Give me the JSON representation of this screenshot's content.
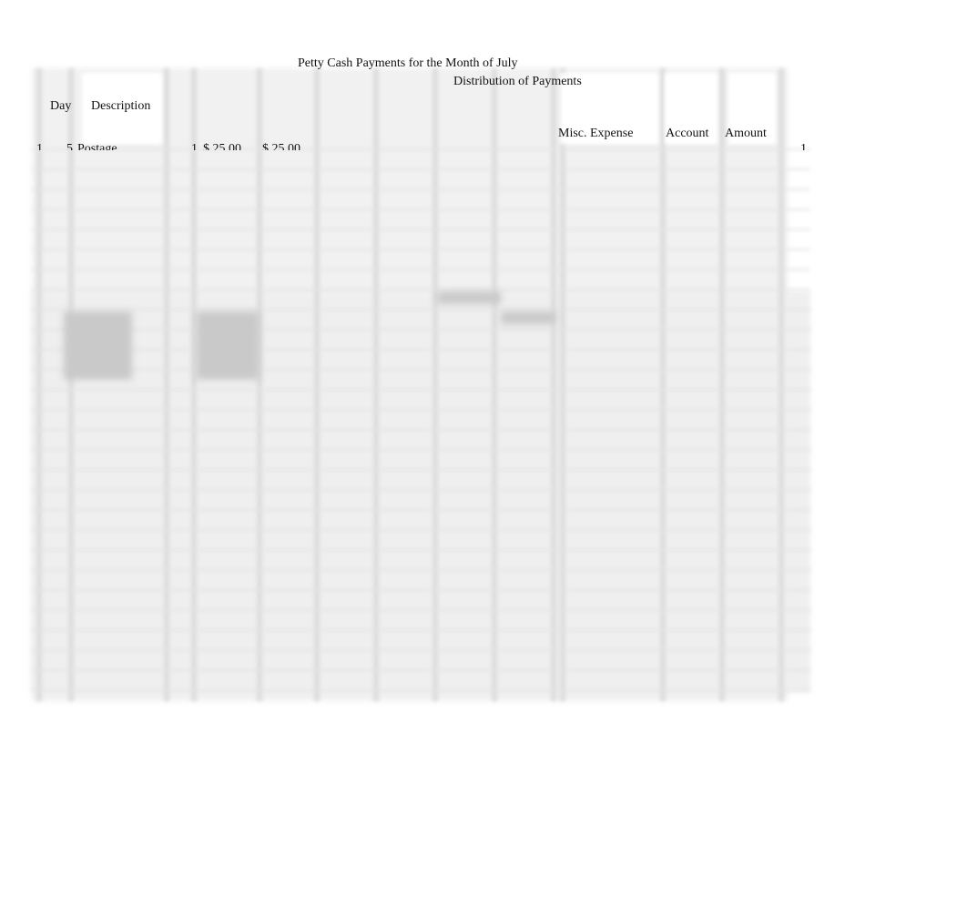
{
  "title": "Petty Cash Payments for the Month of July",
  "distribution_header": "Distribution of Payments",
  "columns": {
    "day": "Day",
    "description": "Description",
    "misc_expense": "Misc. Expense",
    "account": "Account",
    "amount": "Amount"
  },
  "first_row": {
    "row_no": "1",
    "day": "5",
    "description": "Postage",
    "voucher": "1",
    "payment": "$ 25.00",
    "postage": "$ 25.00",
    "right_row_no": "1"
  }
}
